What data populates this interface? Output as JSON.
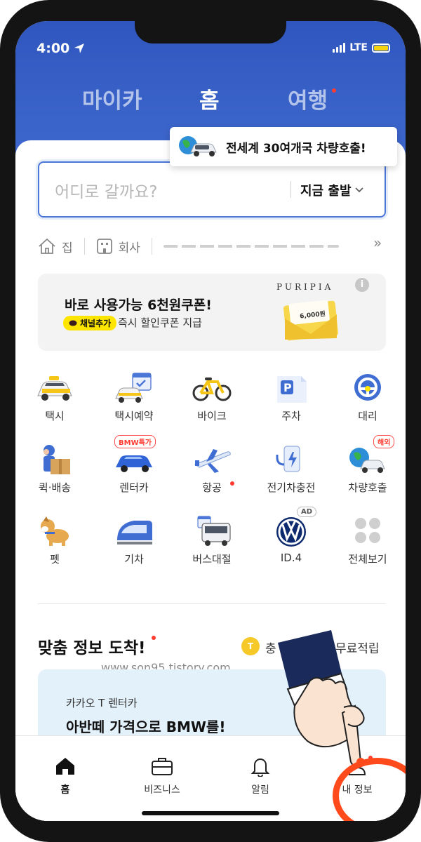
{
  "status_bar": {
    "time": "4:00",
    "network": "LTE"
  },
  "top_tabs": [
    {
      "label": "마이카"
    },
    {
      "label": "홈"
    },
    {
      "label": "여행"
    }
  ],
  "tooltip": {
    "text": "전세계 30여개국 차량호출!"
  },
  "search": {
    "placeholder": "어디로 갈까요?",
    "depart_label": "지금 출발"
  },
  "shortcuts": {
    "home": "집",
    "work": "회사"
  },
  "coupon_banner": {
    "title": "바로 사용가능 6천원쿠폰!",
    "chip": "채널추가",
    "subtitle": "즉시 할인쿠폰 지급",
    "brand": "PURIPIA",
    "coupon_value": "6,000원"
  },
  "services": [
    {
      "label": "택시",
      "icon": "taxi-icon"
    },
    {
      "label": "택시예약",
      "icon": "taxi-reservation-icon"
    },
    {
      "label": "바이크",
      "icon": "bike-icon"
    },
    {
      "label": "주차",
      "icon": "parking-icon"
    },
    {
      "label": "대리",
      "icon": "driver-icon"
    },
    {
      "label": "퀵·배송",
      "icon": "delivery-icon"
    },
    {
      "label": "렌터카",
      "icon": "rental-car-icon",
      "badge": "BMW특가"
    },
    {
      "label": "항공",
      "icon": "airplane-icon"
    },
    {
      "label": "전기차충전",
      "icon": "ev-charger-icon"
    },
    {
      "label": "차량호출",
      "icon": "global-car-icon",
      "badge": "해외"
    },
    {
      "label": "펫",
      "icon": "pet-icon"
    },
    {
      "label": "기차",
      "icon": "train-icon"
    },
    {
      "label": "버스대절",
      "icon": "bus-icon"
    },
    {
      "label": "ID.4",
      "icon": "volkswagen-logo-icon",
      "badge": "AD"
    },
    {
      "label": "전체보기",
      "icon": "view-all-icon"
    }
  ],
  "section": {
    "title": "맞춤 정보 도착!",
    "coin_label": "T",
    "coin_text": "충",
    "free_points": "무료적립"
  },
  "watermark": "www.son95.tistory.com",
  "promo_card": {
    "kicker": "카카오 T 렌터카",
    "title": "아반떼 가격으로 BMW를!"
  },
  "tab_bar": [
    {
      "label": "홈"
    },
    {
      "label": "비즈니스"
    },
    {
      "label": "알림"
    },
    {
      "label": "내 정보"
    }
  ],
  "colors": {
    "primary": "#3a63c9",
    "accent": "#fee500",
    "alert": "#ff3b30",
    "highlight": "#ff4a1c"
  }
}
